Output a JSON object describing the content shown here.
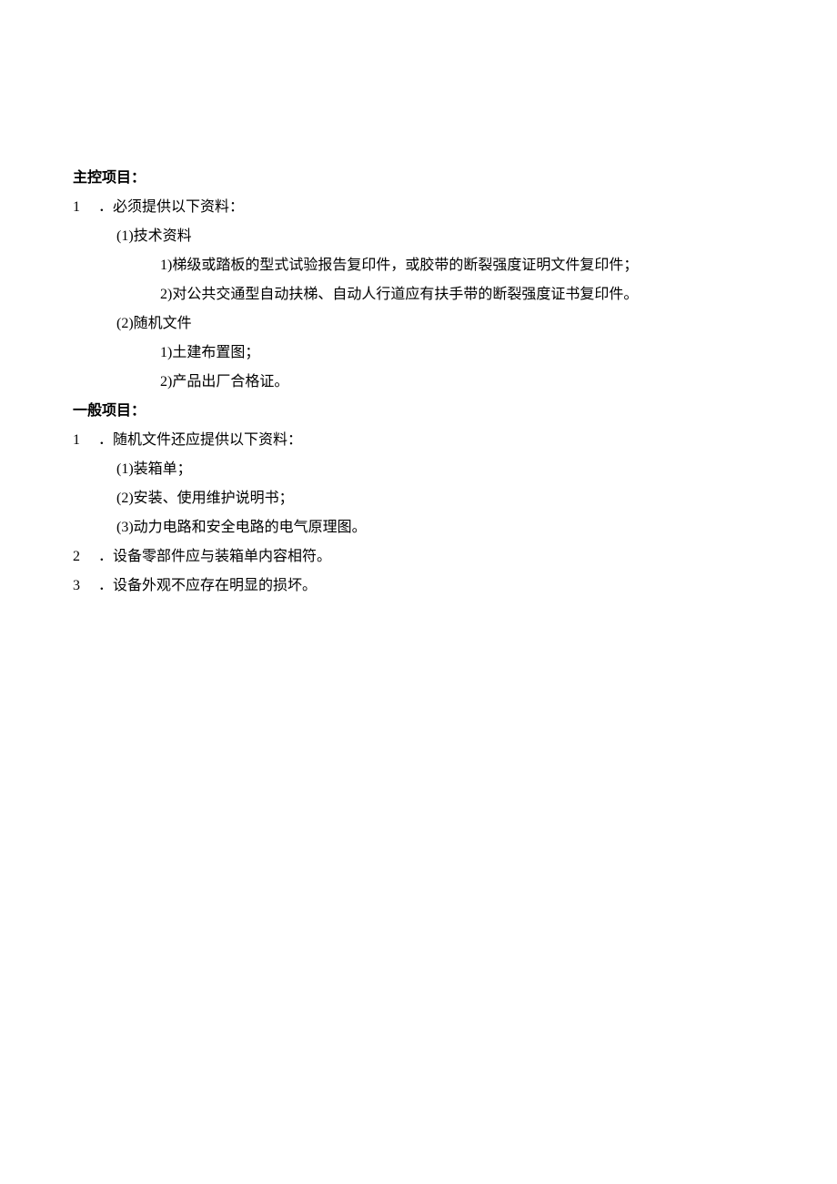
{
  "section1": {
    "heading": "主控项目：",
    "item1": {
      "num": "1",
      "text": "．必须提供以下资料：",
      "sub1": {
        "label": "(1)技术资料",
        "line1": "1)梯级或踏板的型式试验报告复印件，或胶带的断裂强度证明文件复印件；",
        "line2": "2)对公共交通型自动扶梯、自动人行道应有扶手带的断裂强度证书复印件。"
      },
      "sub2": {
        "label": "(2)随机文件",
        "line1": "1)土建布置图；",
        "line2": "2)产品出厂合格证。"
      }
    }
  },
  "section2": {
    "heading": "一般项目：",
    "item1": {
      "num": "1",
      "text": "．随机文件还应提供以下资料：",
      "sub1": "(1)装箱单；",
      "sub2": "(2)安装、使用维护说明书；",
      "sub3": "(3)动力电路和安全电路的电气原理图。"
    },
    "item2": {
      "num": "2",
      "text": "．设备零部件应与装箱单内容相符。"
    },
    "item3": {
      "num": "3",
      "text": "．设备外观不应存在明显的损坏。"
    }
  }
}
